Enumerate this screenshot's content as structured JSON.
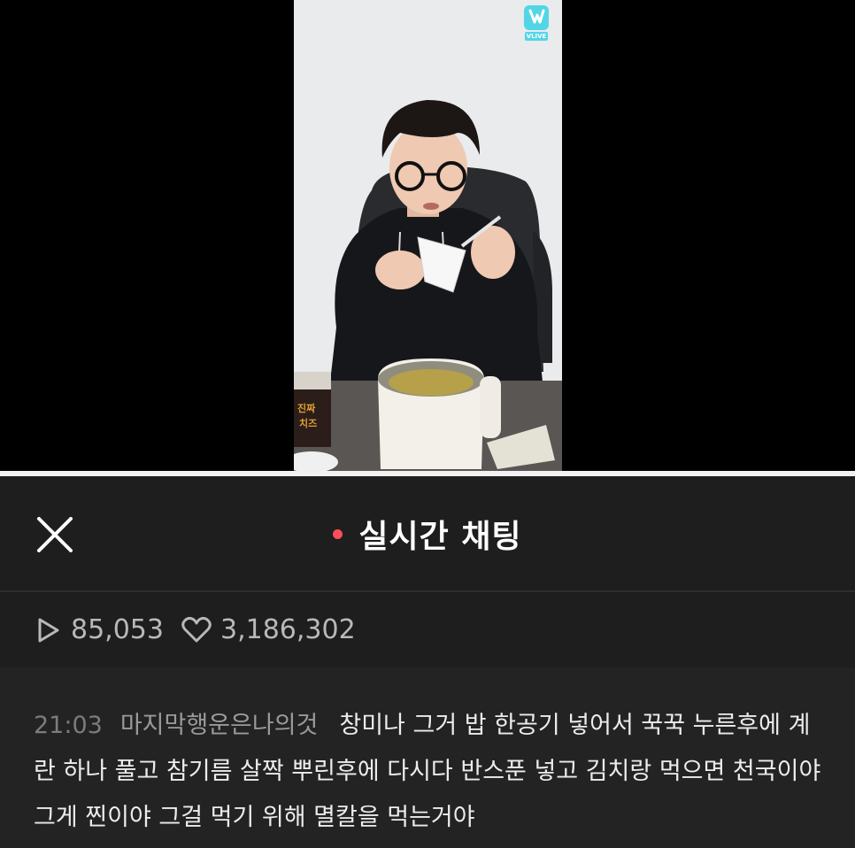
{
  "video": {
    "logo_text": "VLIVE",
    "product_label": "진짜\n치즈"
  },
  "chat_header": {
    "title": "실시간 채팅",
    "live_dot_color": "#ff4d5a",
    "close_icon": "close-icon"
  },
  "stats": {
    "plays": "85,053",
    "hearts": "3,186,302",
    "play_icon": "play-icon",
    "heart_icon": "heart-icon"
  },
  "chat": {
    "messages": [
      {
        "time": "21:03",
        "user": "마지막행운은나의것",
        "text": "창미나 그거 밥 한공기 넣어서 꾹꾹 누른후에 계란 하나 풀고 참기름 살짝 뿌린후에 다시다 반스푼 넣고 김치랑 먹으면 천국이야 그게 찐이야 그걸 먹기 위해 멸칼을 먹는거야"
      }
    ]
  }
}
